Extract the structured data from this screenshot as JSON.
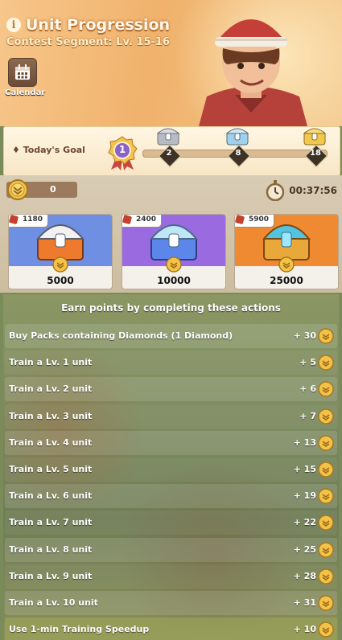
{
  "header": {
    "title": "Unit Progression",
    "subtitle": "Contest Segment: Lv. 15-16",
    "calendar_label": "Calendar"
  },
  "goal": {
    "label": "Today's Goal",
    "current_level": "1",
    "progress": 0.0,
    "milestones": [
      "2",
      "8",
      "18"
    ]
  },
  "rewards": {
    "points": "0",
    "timer": "00:37:56",
    "cards": [
      {
        "cost": "1180",
        "points": "5000",
        "color": "#6f8fe3",
        "chest": "orange-chest-icon"
      },
      {
        "cost": "2400",
        "points": "10000",
        "color": "#9a6ae0",
        "chest": "blue-chest-icon"
      },
      {
        "cost": "5900",
        "points": "25000",
        "color": "#ef8a32",
        "chest": "gold-chest-icon"
      }
    ]
  },
  "actions": {
    "title": "Earn points by completing these actions",
    "items": [
      {
        "name": "Buy Packs containing Diamonds (1 Diamond)",
        "points": "+ 30"
      },
      {
        "name": "Train a Lv. 1 unit",
        "points": "+ 5"
      },
      {
        "name": "Train a Lv. 2 unit",
        "points": "+ 6"
      },
      {
        "name": "Train a Lv. 3 unit",
        "points": "+ 7"
      },
      {
        "name": "Train a Lv. 4 unit",
        "points": "+ 13"
      },
      {
        "name": "Train a Lv. 5 unit",
        "points": "+ 15"
      },
      {
        "name": "Train a Lv. 6 unit",
        "points": "+ 19"
      },
      {
        "name": "Train a Lv. 7 unit",
        "points": "+ 22"
      },
      {
        "name": "Train a Lv. 8 unit",
        "points": "+ 25"
      },
      {
        "name": "Train a Lv. 9 unit",
        "points": "+ 28"
      },
      {
        "name": "Train a Lv. 10 unit",
        "points": "+ 31"
      },
      {
        "name": "Use 1-min Training Speedup",
        "points": "+ 10"
      }
    ]
  },
  "colors": {
    "header_bg": "#f0b26c",
    "coin_gold": "#f2c24a",
    "ruby": "#c4402f"
  }
}
